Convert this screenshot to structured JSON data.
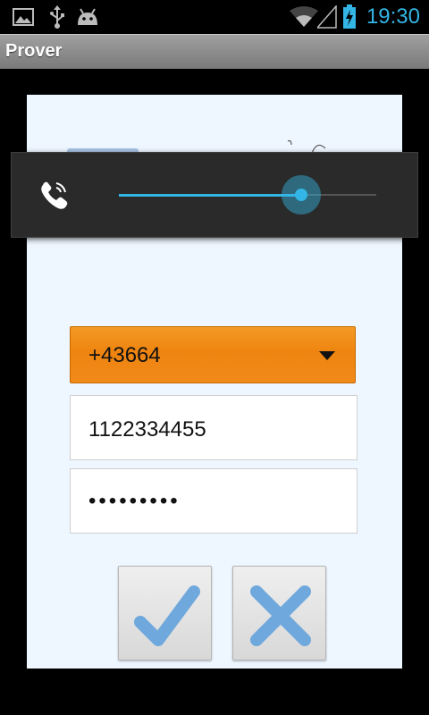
{
  "status_bar": {
    "time": "19:30",
    "icons": [
      "image-icon",
      "usb-icon",
      "android-icon",
      "wifi-icon",
      "signal-icon",
      "battery-charging-icon"
    ],
    "accent_color": "#33b5e5"
  },
  "app": {
    "title": "Prover"
  },
  "form": {
    "country_code": "+43664",
    "phone_number": "1122334455",
    "password_mask": "•••••••••"
  },
  "buttons": {
    "confirm_icon": "checkmark-icon",
    "cancel_icon": "x-icon",
    "icon_color": "#6fa8dc"
  },
  "volume_overlay": {
    "stream_icon": "phone-ring-icon",
    "level": 0.71,
    "accent_color": "#33b5e5"
  }
}
